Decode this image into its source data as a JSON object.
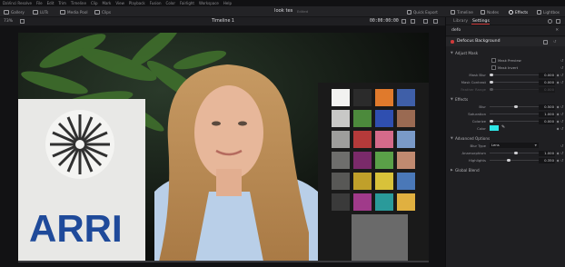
{
  "app": {
    "menu": [
      "DaVinci Resolve",
      "File",
      "Edit",
      "Trim",
      "Timeline",
      "Clip",
      "Mark",
      "View",
      "Playback",
      "Fusion",
      "Color",
      "Fairlight",
      "Workspace",
      "Help"
    ]
  },
  "toolbar": {
    "gallery": "Gallery",
    "luts": "LUTs",
    "media_pool": "Media Pool",
    "clips": "Clips",
    "project_title": "look tes",
    "project_status": "Edited",
    "quick_export": "Quick Export",
    "timeline": "Timeline",
    "nodes": "Nodes",
    "effects": "Effects",
    "lightbox": "Lightbox"
  },
  "viewer": {
    "zoom": "73%",
    "timeline_name": "Timeline 1",
    "timecode": "00:00:00:00",
    "image_text": "ARRI"
  },
  "panel": {
    "tabs": [
      "Library",
      "Settings"
    ],
    "selected_tab": "Settings",
    "search_value": "defo",
    "effect_name": "Defocus Background",
    "sections": {
      "adjust_mask": "Adjust Mask",
      "effects": "Effects",
      "advanced": "Advanced Options",
      "global_blend": "Global Blend"
    },
    "mask_preview": "Mask Preview",
    "mask_invert": "Mask Invert",
    "mask_blur": {
      "label": "Mask Blur",
      "value": "0.000",
      "fraction": 0.0
    },
    "mask_contrast": {
      "label": "Mask Contrast",
      "value": "0.000",
      "fraction": 0.0
    },
    "feather_range": {
      "label": "Feather Range",
      "value": "0.000",
      "fraction": 0.0
    },
    "blur": {
      "label": "Blur",
      "value": "0.500",
      "fraction": 0.5
    },
    "saturation": {
      "label": "Saturation",
      "value": "1.000",
      "fraction": 1.0
    },
    "colorize": {
      "label": "Colorize",
      "value": "0.000",
      "fraction": 0.0
    },
    "color": {
      "label": "Color",
      "hex": "#2ee6e6"
    },
    "blur_type": {
      "label": "Blur Type",
      "value": "Lens"
    },
    "anamorphism": {
      "label": "Anamorphism",
      "value": "1.000",
      "fraction": 0.5
    },
    "highlights": {
      "label": "Highlights",
      "value": "0.350",
      "fraction": 0.35
    }
  },
  "colors": {
    "accent": "#d03a3a",
    "panel_bg": "#1f1f22",
    "viewer_bg": "#121214"
  }
}
